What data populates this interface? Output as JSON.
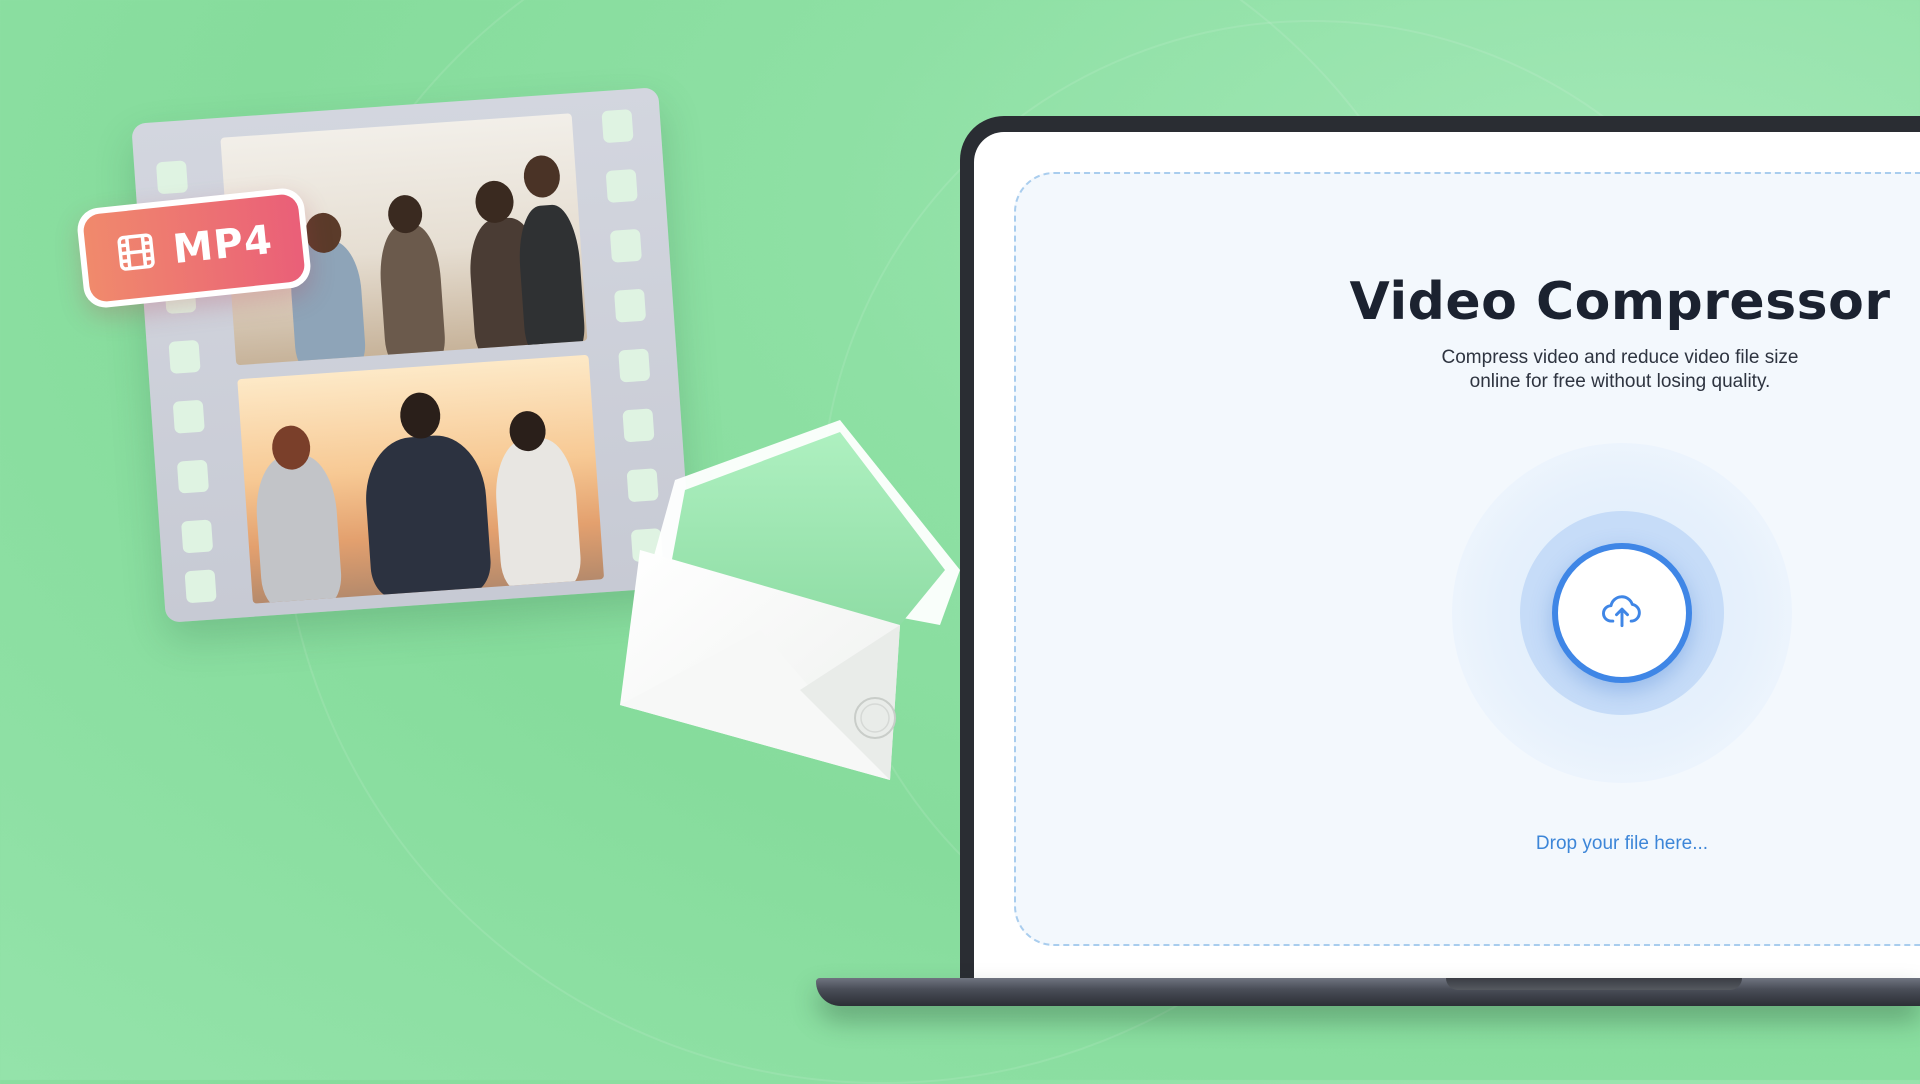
{
  "badge": {
    "format_label": "MP4",
    "icon": "film-icon"
  },
  "compressor": {
    "title": "Video Compressor",
    "subtitle_line1": "Compress video and reduce video file size",
    "subtitle_line2": "online for free without losing quality.",
    "upload_icon": "cloud-upload-icon",
    "drop_text": "Drop your file here..."
  },
  "colors": {
    "background": "#8ee0a4",
    "accent": "#3f86e6",
    "badge_start": "#f08a6c",
    "badge_end": "#ea5f78"
  }
}
